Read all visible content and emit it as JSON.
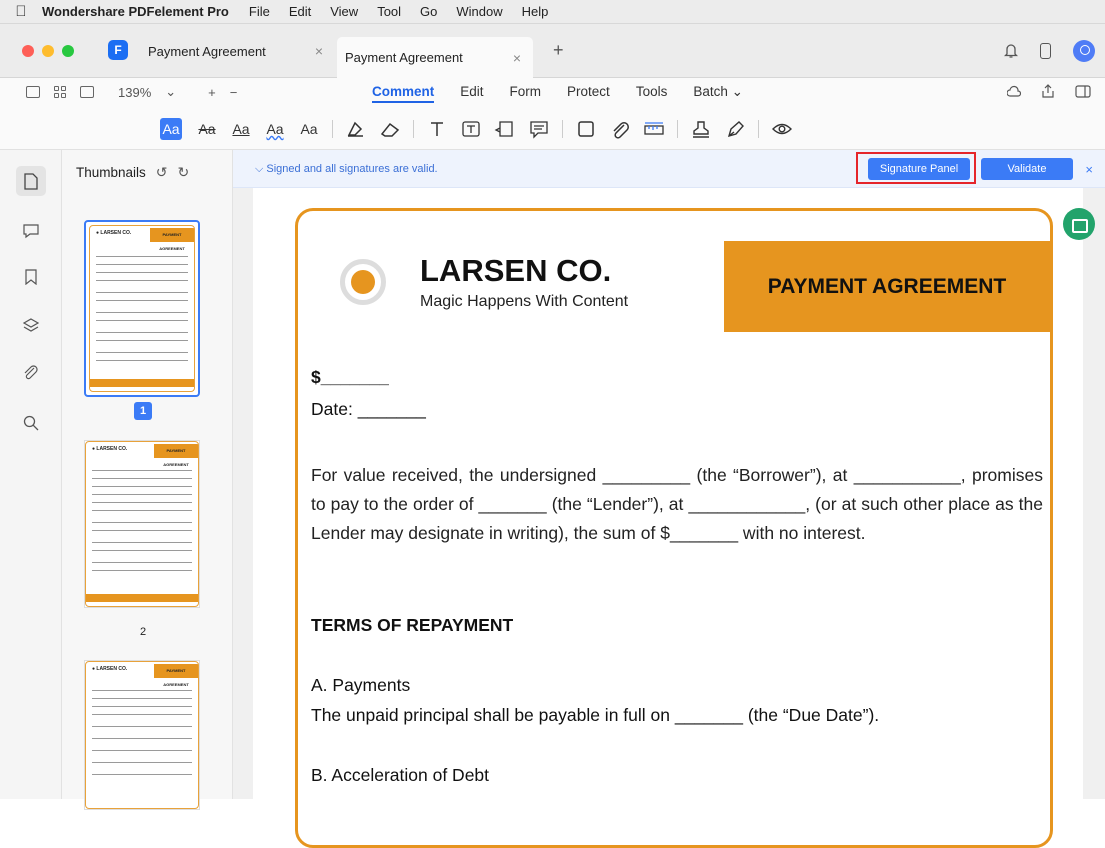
{
  "menubar": {
    "app_name": "Wondershare PDFelement Pro",
    "items": [
      "File",
      "Edit",
      "View",
      "Tool",
      "Go",
      "Window",
      "Help"
    ]
  },
  "tabs": [
    {
      "label": "Payment Agreement",
      "close": "×"
    },
    {
      "label": "Payment Agreement",
      "close": "×"
    }
  ],
  "new_tab": "+",
  "toolbar": {
    "zoom": "139%",
    "zoom_caret": "⌄",
    "zoom_in": "+",
    "zoom_out": "−",
    "tabs": [
      "Comment",
      "Edit",
      "Form",
      "Protect",
      "Tools",
      "Batch ⌄"
    ],
    "active_tab": "Comment"
  },
  "comment_tools": [
    "Aa",
    "Aa",
    "Aa",
    "Aa",
    "Aa"
  ],
  "sidebar": {
    "thumbnails_label": "Thumbnails",
    "rotate_left": "↺",
    "rotate_right": "↻",
    "pages": [
      "1",
      "2"
    ]
  },
  "signature_bar": {
    "message": "⌵  Signed and all signatures are valid.",
    "signature_panel_label": "Signature Panel",
    "validate_label": "Validate",
    "close": "×"
  },
  "document": {
    "company": "LARSEN CO.",
    "tagline": "Magic Happens With Content",
    "badge": "PAYMENT AGREEMENT",
    "amount": "$_______",
    "date": "Date: _______",
    "paragraph": "For value received, the undersigned _________ (the “Borrower”), at ___________, promises to pay to the order of _______ (the “Lender”), at ____________, (or at such other place as the Lender may designate in writing), the sum of $_______ with no interest.",
    "terms_heading": "TERMS OF REPAYMENT",
    "payments_heading": "A. Payments",
    "payments_text": "The unpaid principal shall be payable in full on _______ (the “Due Date”).",
    "acceleration_heading": "B. Acceleration of Debt"
  },
  "colors": {
    "accent": "#3b7bf6",
    "brand_orange": "#e6951f",
    "highlight_red": "#e5252b",
    "fab_green": "#22a36b"
  }
}
